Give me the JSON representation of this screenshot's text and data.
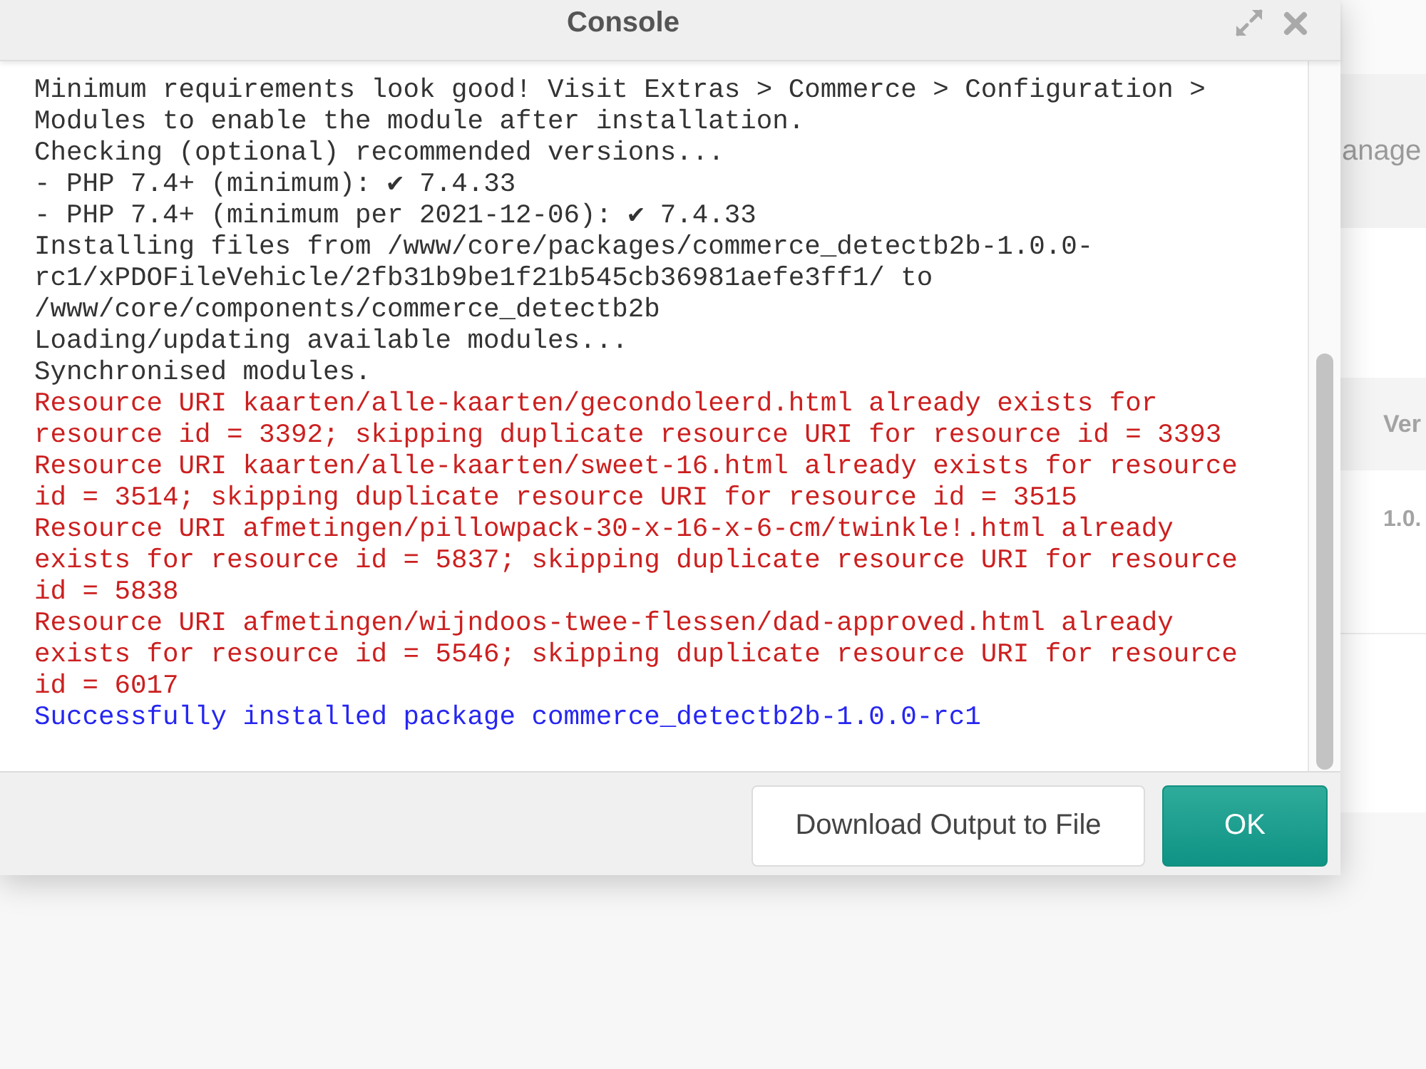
{
  "background_page": {
    "toolbar": {
      "text": "anage"
    },
    "table": {
      "columns": [
        {
          "label": "Ver"
        }
      ],
      "rows": [
        {
          "cells": [
            "1.0."
          ]
        }
      ]
    }
  },
  "dialog": {
    "title": "Console",
    "log": [
      {
        "kind": "info",
        "text": "Minimum requirements look good! Visit Extras > Commerce > Configuration > Modules to enable the module after installation."
      },
      {
        "kind": "info",
        "text": "Checking (optional) recommended versions..."
      },
      {
        "kind": "info",
        "text": "- PHP 7.4+ (minimum): ✔ 7.4.33"
      },
      {
        "kind": "info",
        "text": "- PHP 7.4+ (minimum per 2021-12-06): ✔ 7.4.33"
      },
      {
        "kind": "info",
        "text": "Installing files from /www/core/packages/commerce_detectb2b-1.0.0-rc1/xPDOFileVehicle/2fb31b9be1f21b545cb36981aefe3ff1/ to /www/core/components/commerce_detectb2b"
      },
      {
        "kind": "info",
        "text": "Loading/updating available modules..."
      },
      {
        "kind": "info",
        "text": "Synchronised modules."
      },
      {
        "kind": "error",
        "text": "Resource URI kaarten/alle-kaarten/gecondoleerd.html already exists for resource id = 3392; skipping duplicate resource URI for resource id = 3393"
      },
      {
        "kind": "error",
        "text": "Resource URI kaarten/alle-kaarten/sweet-16.html already exists for resource id = 3514; skipping duplicate resource URI for resource id = 3515"
      },
      {
        "kind": "error",
        "text": "Resource URI afmetingen/pillowpack-30-x-16-x-6-cm/twinkle!.html already exists for resource id = 5837; skipping duplicate resource URI for resource id = 5838"
      },
      {
        "kind": "error",
        "text": "Resource URI afmetingen/wijndoos-twee-flessen/dad-approved.html already exists for resource id = 5546; skipping duplicate resource URI for resource id = 6017"
      },
      {
        "kind": "success",
        "text": "Successfully installed package commerce_detectb2b-1.0.0-rc1"
      }
    ],
    "buttons": [
      {
        "kind": "secondary",
        "label": "Download Output to File"
      },
      {
        "kind": "primary",
        "label": "OK"
      }
    ]
  }
}
